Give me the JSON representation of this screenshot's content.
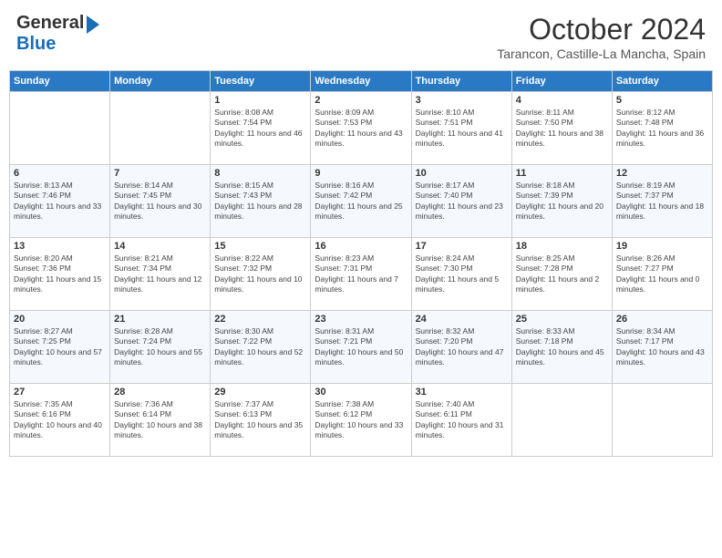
{
  "header": {
    "logo_general": "General",
    "logo_blue": "Blue",
    "month": "October 2024",
    "location": "Tarancon, Castille-La Mancha, Spain"
  },
  "days_of_week": [
    "Sunday",
    "Monday",
    "Tuesday",
    "Wednesday",
    "Thursday",
    "Friday",
    "Saturday"
  ],
  "weeks": [
    [
      {
        "day": "",
        "info": ""
      },
      {
        "day": "",
        "info": ""
      },
      {
        "day": "1",
        "info": "Sunrise: 8:08 AM\nSunset: 7:54 PM\nDaylight: 11 hours and 46 minutes."
      },
      {
        "day": "2",
        "info": "Sunrise: 8:09 AM\nSunset: 7:53 PM\nDaylight: 11 hours and 43 minutes."
      },
      {
        "day": "3",
        "info": "Sunrise: 8:10 AM\nSunset: 7:51 PM\nDaylight: 11 hours and 41 minutes."
      },
      {
        "day": "4",
        "info": "Sunrise: 8:11 AM\nSunset: 7:50 PM\nDaylight: 11 hours and 38 minutes."
      },
      {
        "day": "5",
        "info": "Sunrise: 8:12 AM\nSunset: 7:48 PM\nDaylight: 11 hours and 36 minutes."
      }
    ],
    [
      {
        "day": "6",
        "info": "Sunrise: 8:13 AM\nSunset: 7:46 PM\nDaylight: 11 hours and 33 minutes."
      },
      {
        "day": "7",
        "info": "Sunrise: 8:14 AM\nSunset: 7:45 PM\nDaylight: 11 hours and 30 minutes."
      },
      {
        "day": "8",
        "info": "Sunrise: 8:15 AM\nSunset: 7:43 PM\nDaylight: 11 hours and 28 minutes."
      },
      {
        "day": "9",
        "info": "Sunrise: 8:16 AM\nSunset: 7:42 PM\nDaylight: 11 hours and 25 minutes."
      },
      {
        "day": "10",
        "info": "Sunrise: 8:17 AM\nSunset: 7:40 PM\nDaylight: 11 hours and 23 minutes."
      },
      {
        "day": "11",
        "info": "Sunrise: 8:18 AM\nSunset: 7:39 PM\nDaylight: 11 hours and 20 minutes."
      },
      {
        "day": "12",
        "info": "Sunrise: 8:19 AM\nSunset: 7:37 PM\nDaylight: 11 hours and 18 minutes."
      }
    ],
    [
      {
        "day": "13",
        "info": "Sunrise: 8:20 AM\nSunset: 7:36 PM\nDaylight: 11 hours and 15 minutes."
      },
      {
        "day": "14",
        "info": "Sunrise: 8:21 AM\nSunset: 7:34 PM\nDaylight: 11 hours and 12 minutes."
      },
      {
        "day": "15",
        "info": "Sunrise: 8:22 AM\nSunset: 7:32 PM\nDaylight: 11 hours and 10 minutes."
      },
      {
        "day": "16",
        "info": "Sunrise: 8:23 AM\nSunset: 7:31 PM\nDaylight: 11 hours and 7 minutes."
      },
      {
        "day": "17",
        "info": "Sunrise: 8:24 AM\nSunset: 7:30 PM\nDaylight: 11 hours and 5 minutes."
      },
      {
        "day": "18",
        "info": "Sunrise: 8:25 AM\nSunset: 7:28 PM\nDaylight: 11 hours and 2 minutes."
      },
      {
        "day": "19",
        "info": "Sunrise: 8:26 AM\nSunset: 7:27 PM\nDaylight: 11 hours and 0 minutes."
      }
    ],
    [
      {
        "day": "20",
        "info": "Sunrise: 8:27 AM\nSunset: 7:25 PM\nDaylight: 10 hours and 57 minutes."
      },
      {
        "day": "21",
        "info": "Sunrise: 8:28 AM\nSunset: 7:24 PM\nDaylight: 10 hours and 55 minutes."
      },
      {
        "day": "22",
        "info": "Sunrise: 8:30 AM\nSunset: 7:22 PM\nDaylight: 10 hours and 52 minutes."
      },
      {
        "day": "23",
        "info": "Sunrise: 8:31 AM\nSunset: 7:21 PM\nDaylight: 10 hours and 50 minutes."
      },
      {
        "day": "24",
        "info": "Sunrise: 8:32 AM\nSunset: 7:20 PM\nDaylight: 10 hours and 47 minutes."
      },
      {
        "day": "25",
        "info": "Sunrise: 8:33 AM\nSunset: 7:18 PM\nDaylight: 10 hours and 45 minutes."
      },
      {
        "day": "26",
        "info": "Sunrise: 8:34 AM\nSunset: 7:17 PM\nDaylight: 10 hours and 43 minutes."
      }
    ],
    [
      {
        "day": "27",
        "info": "Sunrise: 7:35 AM\nSunset: 6:16 PM\nDaylight: 10 hours and 40 minutes."
      },
      {
        "day": "28",
        "info": "Sunrise: 7:36 AM\nSunset: 6:14 PM\nDaylight: 10 hours and 38 minutes."
      },
      {
        "day": "29",
        "info": "Sunrise: 7:37 AM\nSunset: 6:13 PM\nDaylight: 10 hours and 35 minutes."
      },
      {
        "day": "30",
        "info": "Sunrise: 7:38 AM\nSunset: 6:12 PM\nDaylight: 10 hours and 33 minutes."
      },
      {
        "day": "31",
        "info": "Sunrise: 7:40 AM\nSunset: 6:11 PM\nDaylight: 10 hours and 31 minutes."
      },
      {
        "day": "",
        "info": ""
      },
      {
        "day": "",
        "info": ""
      }
    ]
  ]
}
